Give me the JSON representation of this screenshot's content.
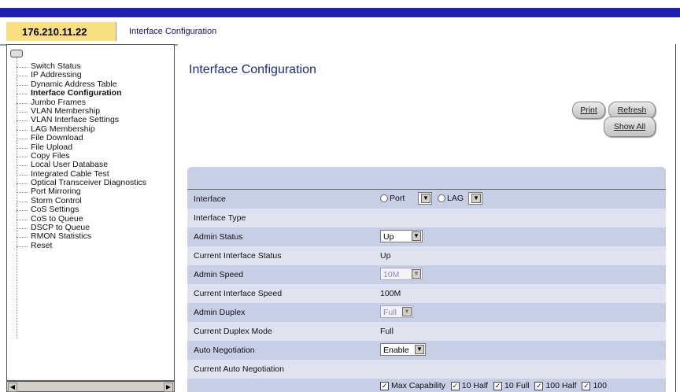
{
  "header": {
    "ip_address": "176.210.11.22",
    "section_title": "Interface Configuration"
  },
  "sidebar": {
    "items": [
      {
        "label": "Switch Status"
      },
      {
        "label": "IP Addressing"
      },
      {
        "label": "Dynamic Address Table"
      },
      {
        "label": "Interface Configuration",
        "active": true
      },
      {
        "label": "Jumbo Frames"
      },
      {
        "label": "VLAN Membership"
      },
      {
        "label": "VLAN Interface Settings"
      },
      {
        "label": "LAG Membership"
      },
      {
        "label": "File Download"
      },
      {
        "label": "File Upload"
      },
      {
        "label": "Copy Files"
      },
      {
        "label": "Local User Database"
      },
      {
        "label": "Integrated Cable Test"
      },
      {
        "label": "Optical Transceiver Diagnostics"
      },
      {
        "label": "Port Mirroring"
      },
      {
        "label": "Storm Control"
      },
      {
        "label": "CoS Settings"
      },
      {
        "label": "CoS to Queue"
      },
      {
        "label": "DSCP to Queue"
      },
      {
        "label": "RMON Statistics"
      },
      {
        "label": "Reset"
      }
    ]
  },
  "main": {
    "title": "Interface Configuration",
    "print_label": "Print",
    "refresh_label": "Refresh",
    "show_all_label": "Show All"
  },
  "form": {
    "interface_label": "Interface",
    "port_label": "Port",
    "lag_label": "LAG",
    "interface_type_label": "Interface Type",
    "admin_status_label": "Admin Status",
    "admin_status_value": "Up",
    "current_status_label": "Current Interface Status",
    "current_status_value": "Up",
    "admin_speed_label": "Admin Speed",
    "admin_speed_value": "10M",
    "current_speed_label": "Current Interface Speed",
    "current_speed_value": "100M",
    "admin_duplex_label": "Admin Duplex",
    "admin_duplex_value": "Full",
    "current_duplex_label": "Current Duplex Mode",
    "current_duplex_value": "Full",
    "auto_neg_label": "Auto Negotiation",
    "auto_neg_value": "Enable",
    "current_auto_neg_label": "Current Auto Negotiation",
    "capabilities": [
      "Max Capability",
      "10 Half",
      "10 Full",
      "100 Half",
      "100"
    ]
  },
  "colors": {
    "top_bar": "#1f1fb4",
    "ip_box": "#f7df82",
    "panel": "#c7cfe6",
    "title_text": "#1a2b8c"
  }
}
